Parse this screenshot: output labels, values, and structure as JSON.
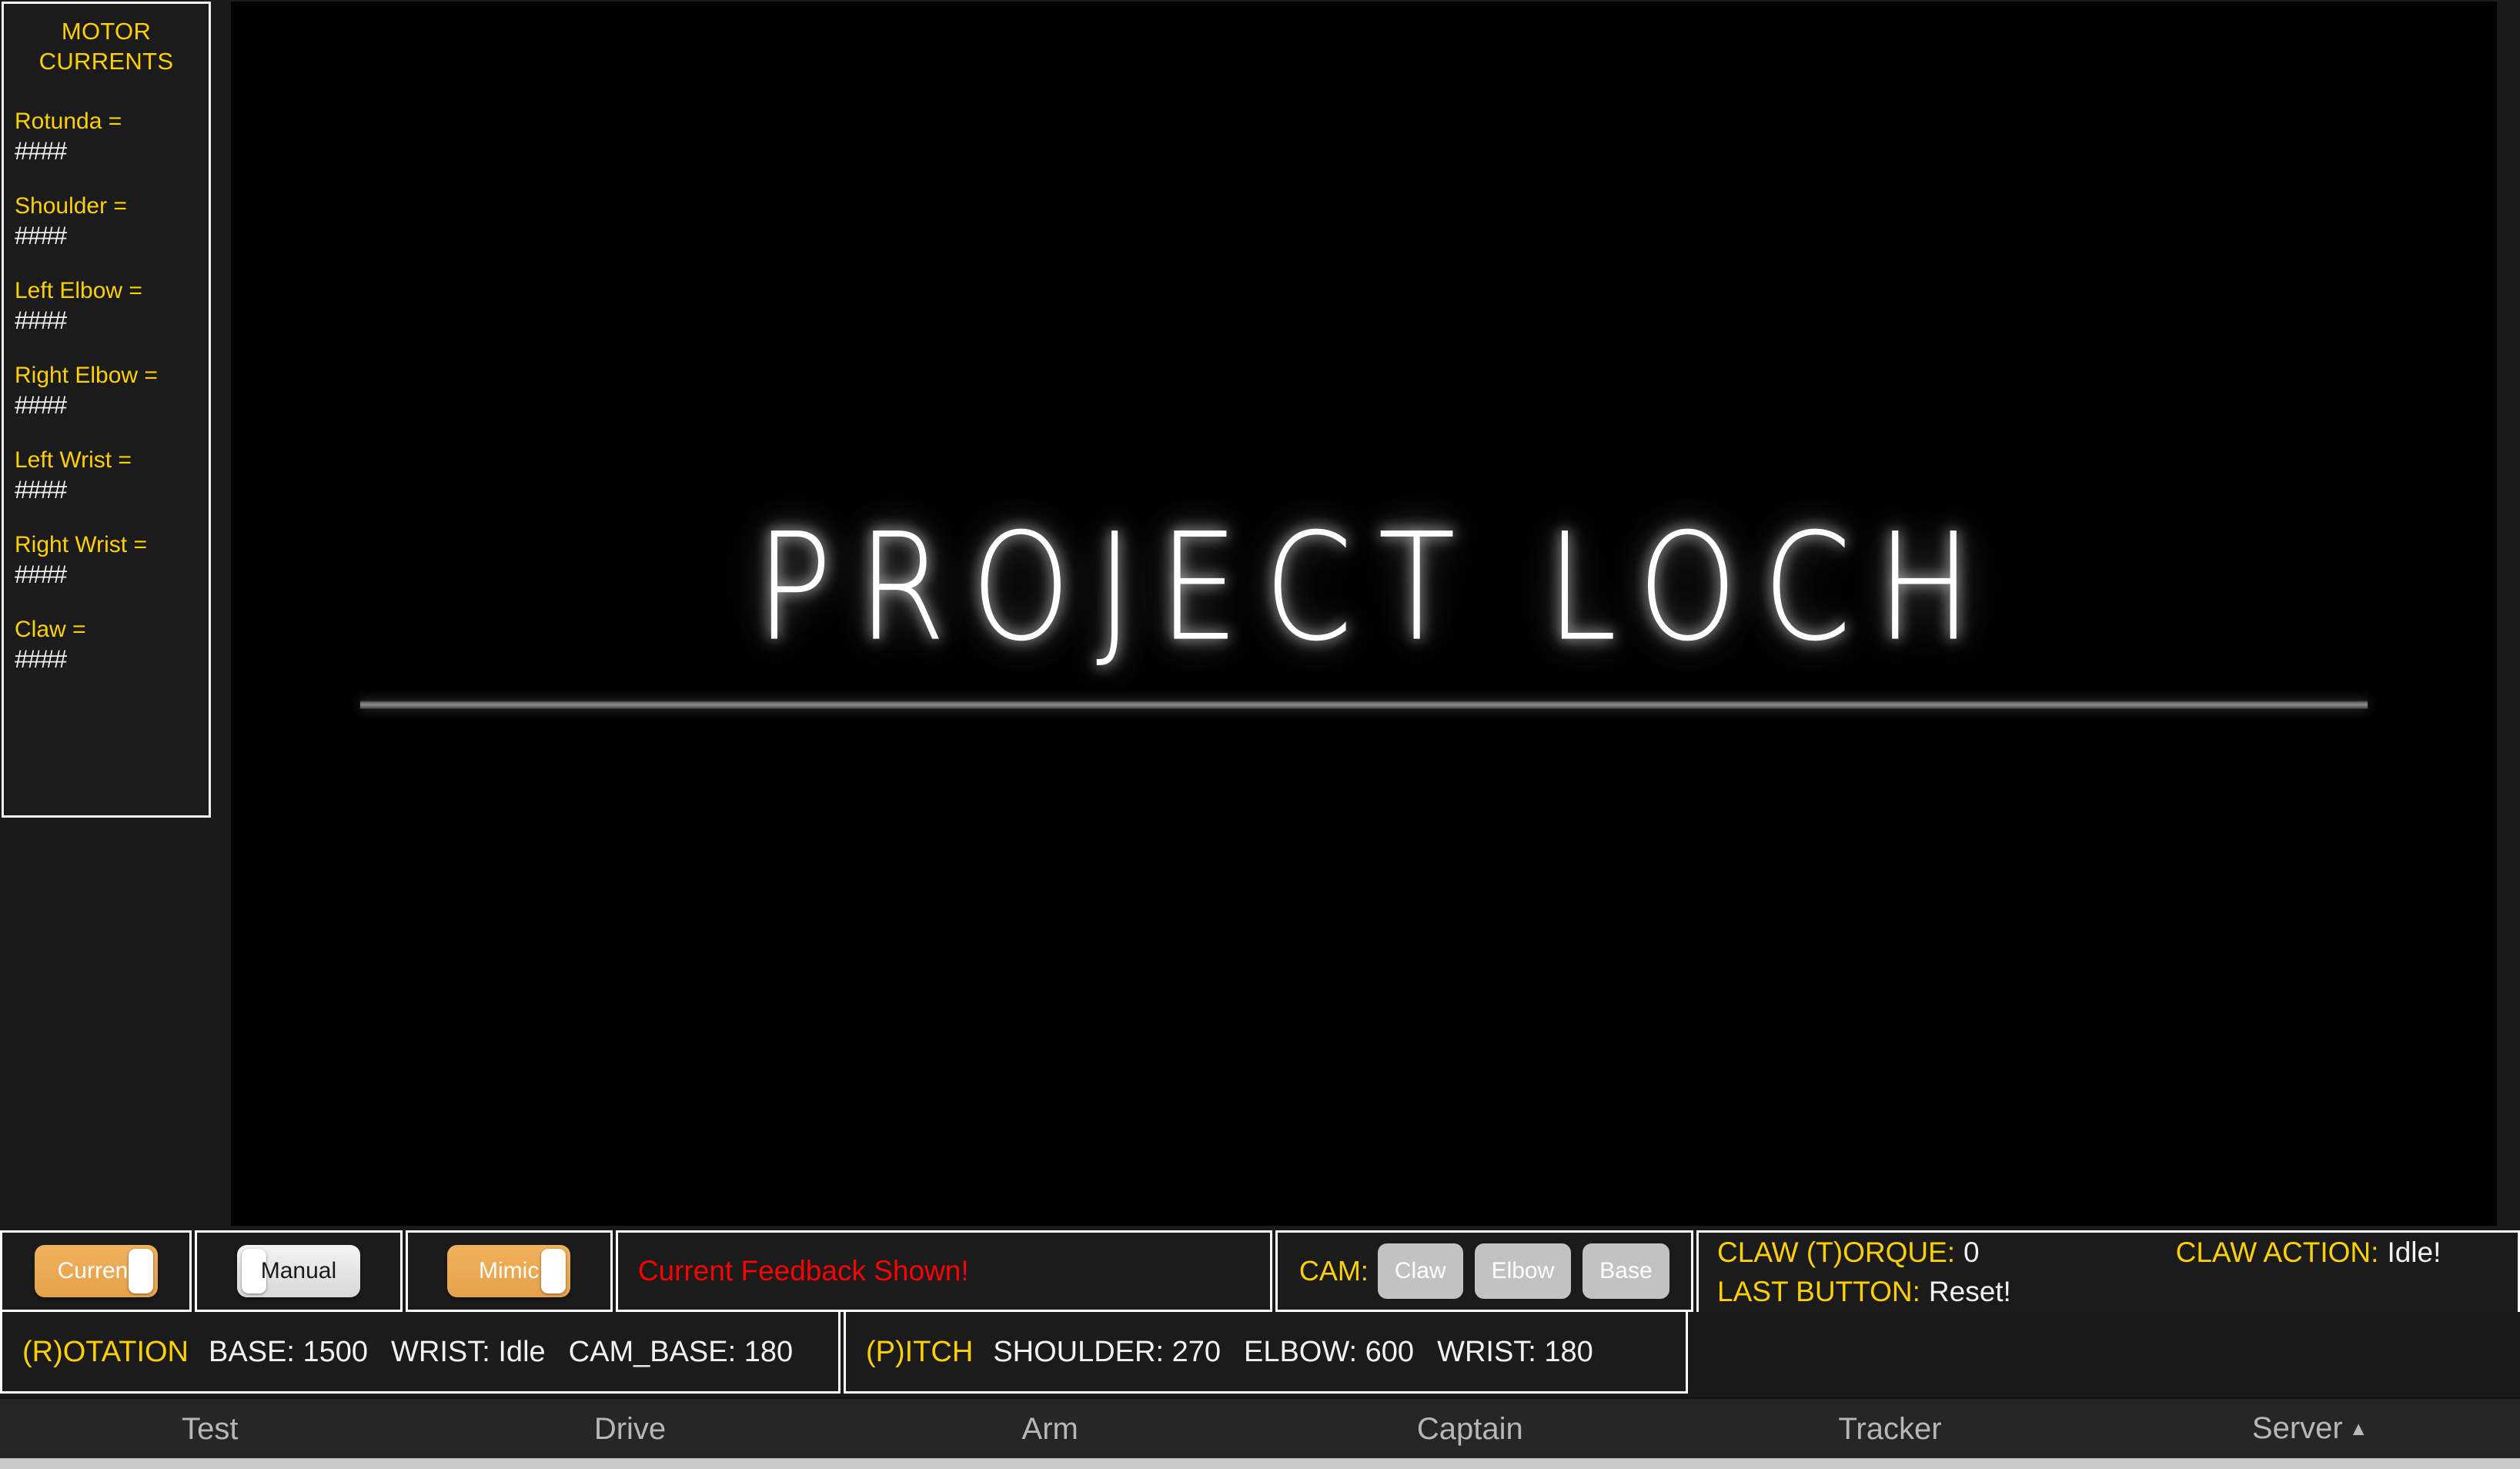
{
  "motor_panel": {
    "title": "MOTOR\nCURRENTS",
    "rows": [
      {
        "label": "Rotunda =",
        "value": "####"
      },
      {
        "label": "Shoulder =",
        "value": "####"
      },
      {
        "label": "Left Elbow =",
        "value": "####"
      },
      {
        "label": "Right Elbow =",
        "value": "####"
      },
      {
        "label": "Left Wrist =",
        "value": "####"
      },
      {
        "label": "Right Wrist =",
        "value": "####"
      },
      {
        "label": "Claw =",
        "value": "####"
      }
    ]
  },
  "viewport": {
    "logo": "PROJECT LOCH"
  },
  "status": {
    "toggles": [
      {
        "label": "Current",
        "state": "on"
      },
      {
        "label": "Manual",
        "state": "off"
      },
      {
        "label": "Mimic",
        "state": "on"
      }
    ],
    "feedback": "Current Feedback Shown!",
    "cam": {
      "label": "CAM:",
      "buttons": [
        "Claw",
        "Elbow",
        "Base"
      ]
    },
    "claw_torque": {
      "key": "CLAW (T)ORQUE:",
      "value": "0"
    },
    "claw_action": {
      "key": "CLAW ACTION:",
      "value": "Idle!"
    },
    "last_button": {
      "key": "LAST BUTTON:",
      "value": "Reset!"
    },
    "rotation": {
      "tag": "(R)OTATION",
      "items": [
        "BASE: 1500",
        "WRIST: Idle",
        "CAM_BASE: 180"
      ]
    },
    "pitch": {
      "tag": "(P)ITCH",
      "items": [
        "SHOULDER: 270",
        "ELBOW: 600",
        "WRIST: 180"
      ]
    }
  },
  "tabs": [
    {
      "label": "Test",
      "caret": ""
    },
    {
      "label": "Drive",
      "caret": ""
    },
    {
      "label": "Arm",
      "caret": ""
    },
    {
      "label": "Captain",
      "caret": ""
    },
    {
      "label": "Tracker",
      "caret": ""
    },
    {
      "label": "Server",
      "caret": "▲"
    }
  ],
  "colors": {
    "accent_yellow": "#ffd000",
    "alert_red": "#ff0000",
    "toggle_on": "#e6a14a",
    "cam_button": "#c2c2c2",
    "page_bg": "#1a1a1a",
    "viewport_bg": "#000000"
  }
}
